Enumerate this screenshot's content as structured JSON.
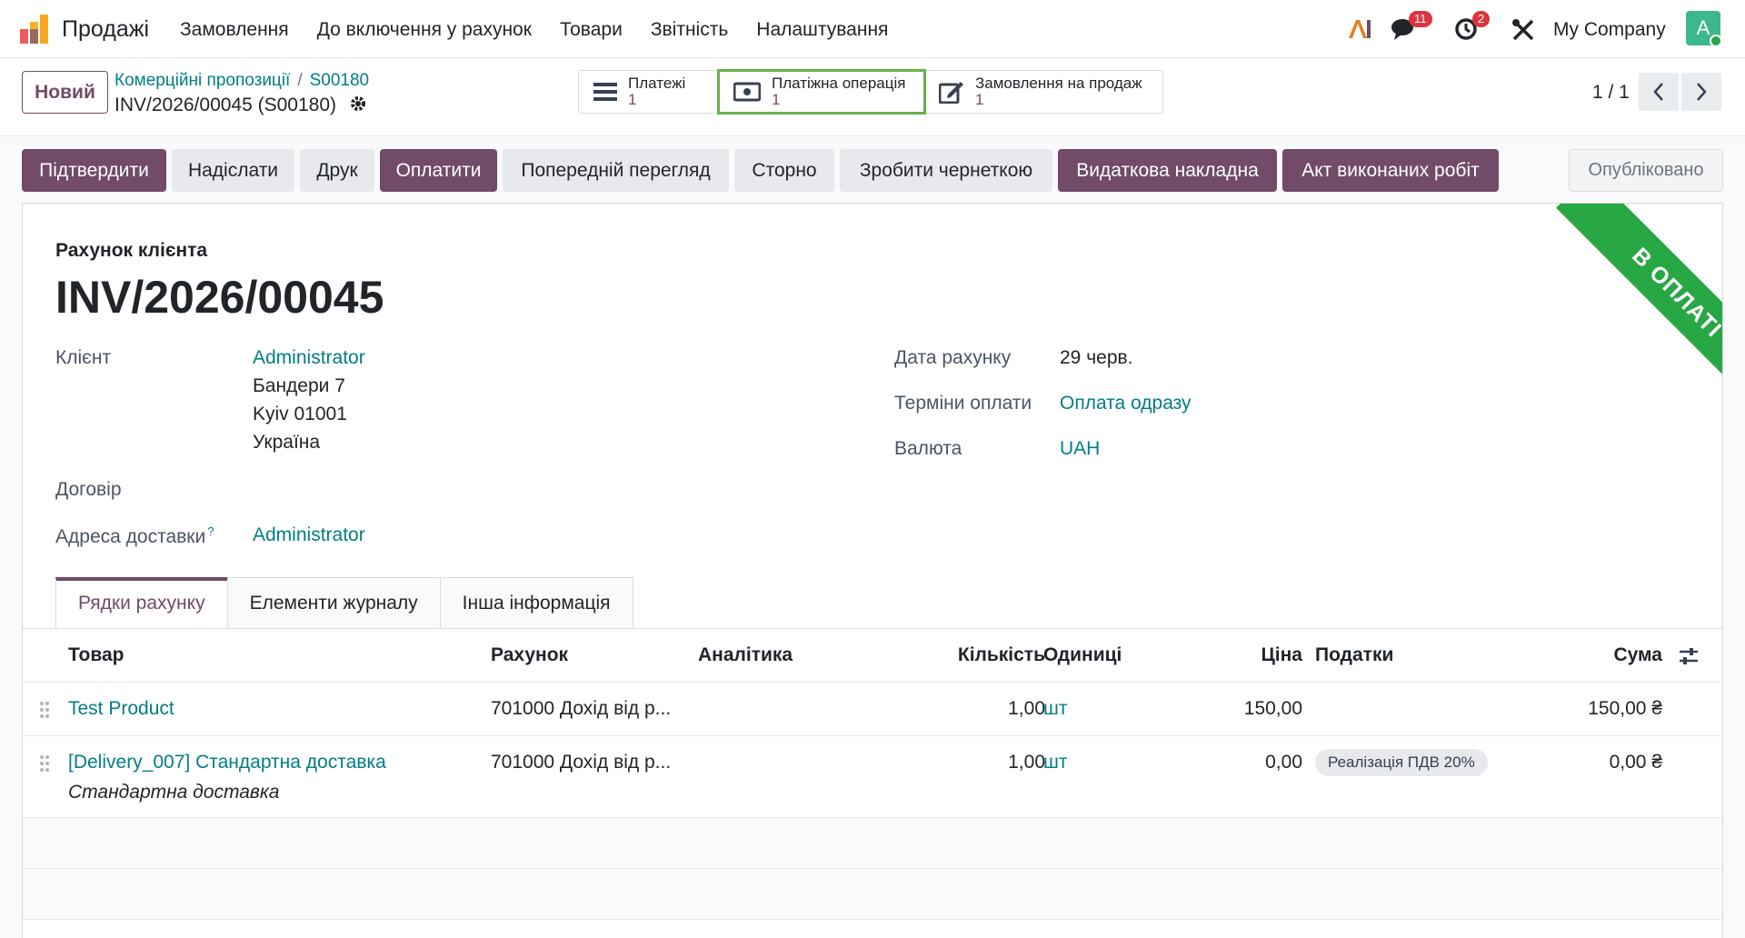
{
  "navbar": {
    "app_name": "Продажі",
    "menu": [
      "Замовлення",
      "До включення у рахунок",
      "Товари",
      "Звітність",
      "Налаштування"
    ],
    "messages_count": "11",
    "activities_count": "2",
    "company": "My Company",
    "avatar_letter": "A"
  },
  "control": {
    "new_button": "Новий",
    "breadcrumb": [
      "Комерційні пропозиції",
      "S00180"
    ],
    "record_title": "INV/2026/00045 (S00180)",
    "smart_buttons": [
      {
        "label": "Платежі",
        "count": "1"
      },
      {
        "label": "Платіжна операція",
        "count": "1"
      },
      {
        "label": "Замовлення на продаж",
        "count": "1"
      }
    ],
    "pager": "1 / 1"
  },
  "actions": {
    "confirm": "Підтвердити",
    "send": "Надіслати",
    "print": "Друк",
    "pay": "Оплатити",
    "preview": "Попередній перегляд",
    "reverse": "Сторно",
    "reset_draft": "Зробити чернеткою",
    "delivery_note": "Видаткова накладна",
    "act_of_work": "Акт виконаних робіт",
    "status": "Опубліковано"
  },
  "form": {
    "ribbon": "В ОПЛАТІ",
    "doc_type": "Рахунок клієнта",
    "doc_number": "INV/2026/00045",
    "customer_label": "Клієнт",
    "customer_name": "Administrator",
    "address": [
      "Бандери 7",
      "Kyiv 01001",
      "Україна"
    ],
    "contract_label": "Договір",
    "delivery_label": "Адреса доставки",
    "delivery_help": "?",
    "delivery_value": "Administrator",
    "invoice_date_label": "Дата рахунку",
    "invoice_date": "29 черв.",
    "payment_terms_label": "Терміни оплати",
    "payment_terms": "Оплата одразу",
    "currency_label": "Валюта",
    "currency": "UAH"
  },
  "tabs": [
    "Рядки рахунку",
    "Елементи журналу",
    "Інша інформація"
  ],
  "table": {
    "headers": {
      "product": "Товар",
      "account": "Рахунок",
      "analytic": "Аналітика",
      "quantity": "Кількість",
      "uom": "Одиниці",
      "price": "Ціна",
      "taxes": "Податки",
      "amount": "Сума"
    },
    "rows": [
      {
        "product": "Test Product",
        "account": "701000 Дохід від р...",
        "quantity": "1,00",
        "uom": "шт",
        "price": "150,00",
        "tax": "",
        "amount": "150,00 ₴",
        "sub": ""
      },
      {
        "product": "[Delivery_007] Стандартна доставка",
        "account": "701000 Дохід від р...",
        "quantity": "1,00",
        "uom": "шт",
        "price": "0,00",
        "tax": "Реалізація ПДВ 20%",
        "amount": "0,00 ₴",
        "sub": "Стандартна доставка"
      }
    ]
  },
  "colors": {
    "primary": "#714b67",
    "link": "#017e84",
    "ribbon": "#28a745"
  }
}
